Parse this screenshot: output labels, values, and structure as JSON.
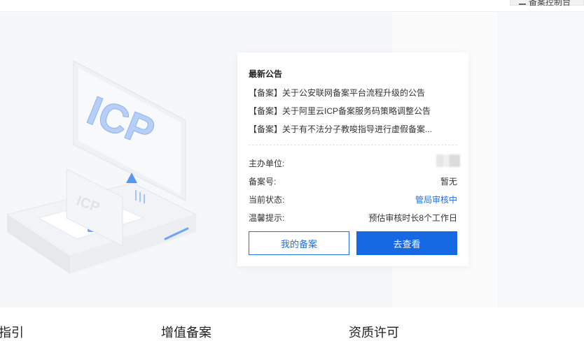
{
  "topbar": {
    "button_label": "备案控制台"
  },
  "notice": {
    "title": "最新公告",
    "items": [
      "【备案】关于公安联网备案平台流程升级的公告",
      "【备案】关于阿里云ICP备案服务码策略调整公告",
      "【备案】关于有不法分子教唆指导进行虚假备案..."
    ]
  },
  "info": {
    "sponsor_label": "主办单位:",
    "record_no_label": "备案号:",
    "record_no_value": "暂无",
    "status_label": "当前状态:",
    "status_value": "管局审核中",
    "tip_label": "温馨提示:",
    "tip_value": "预估审核时长8个工作日"
  },
  "buttons": {
    "my_record": "我的备案",
    "go_view": "去查看"
  },
  "illustration": {
    "text": "ICP"
  },
  "sections": [
    "指引",
    "增值备案",
    "资质许可"
  ],
  "colors": {
    "primary": "#1668e3",
    "link": "#1f6fe0",
    "accent_light": "#6ea3f5"
  }
}
